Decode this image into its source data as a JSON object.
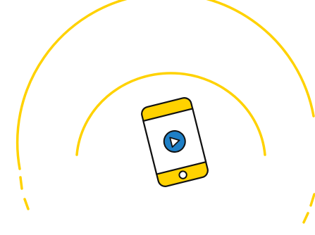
{
  "illustration": {
    "subject": "phone-with-play-button-and-signal-waves",
    "colors": {
      "accent_yellow": "#FFD200",
      "play_blue": "#1E7FC6",
      "outline": "#111111",
      "screen_background": "#FFFFFF",
      "page_background": "#FFFFFF"
    },
    "icons": {
      "device": "smartphone-icon",
      "media": "play-icon",
      "waves": "signal-wave-icon"
    }
  }
}
